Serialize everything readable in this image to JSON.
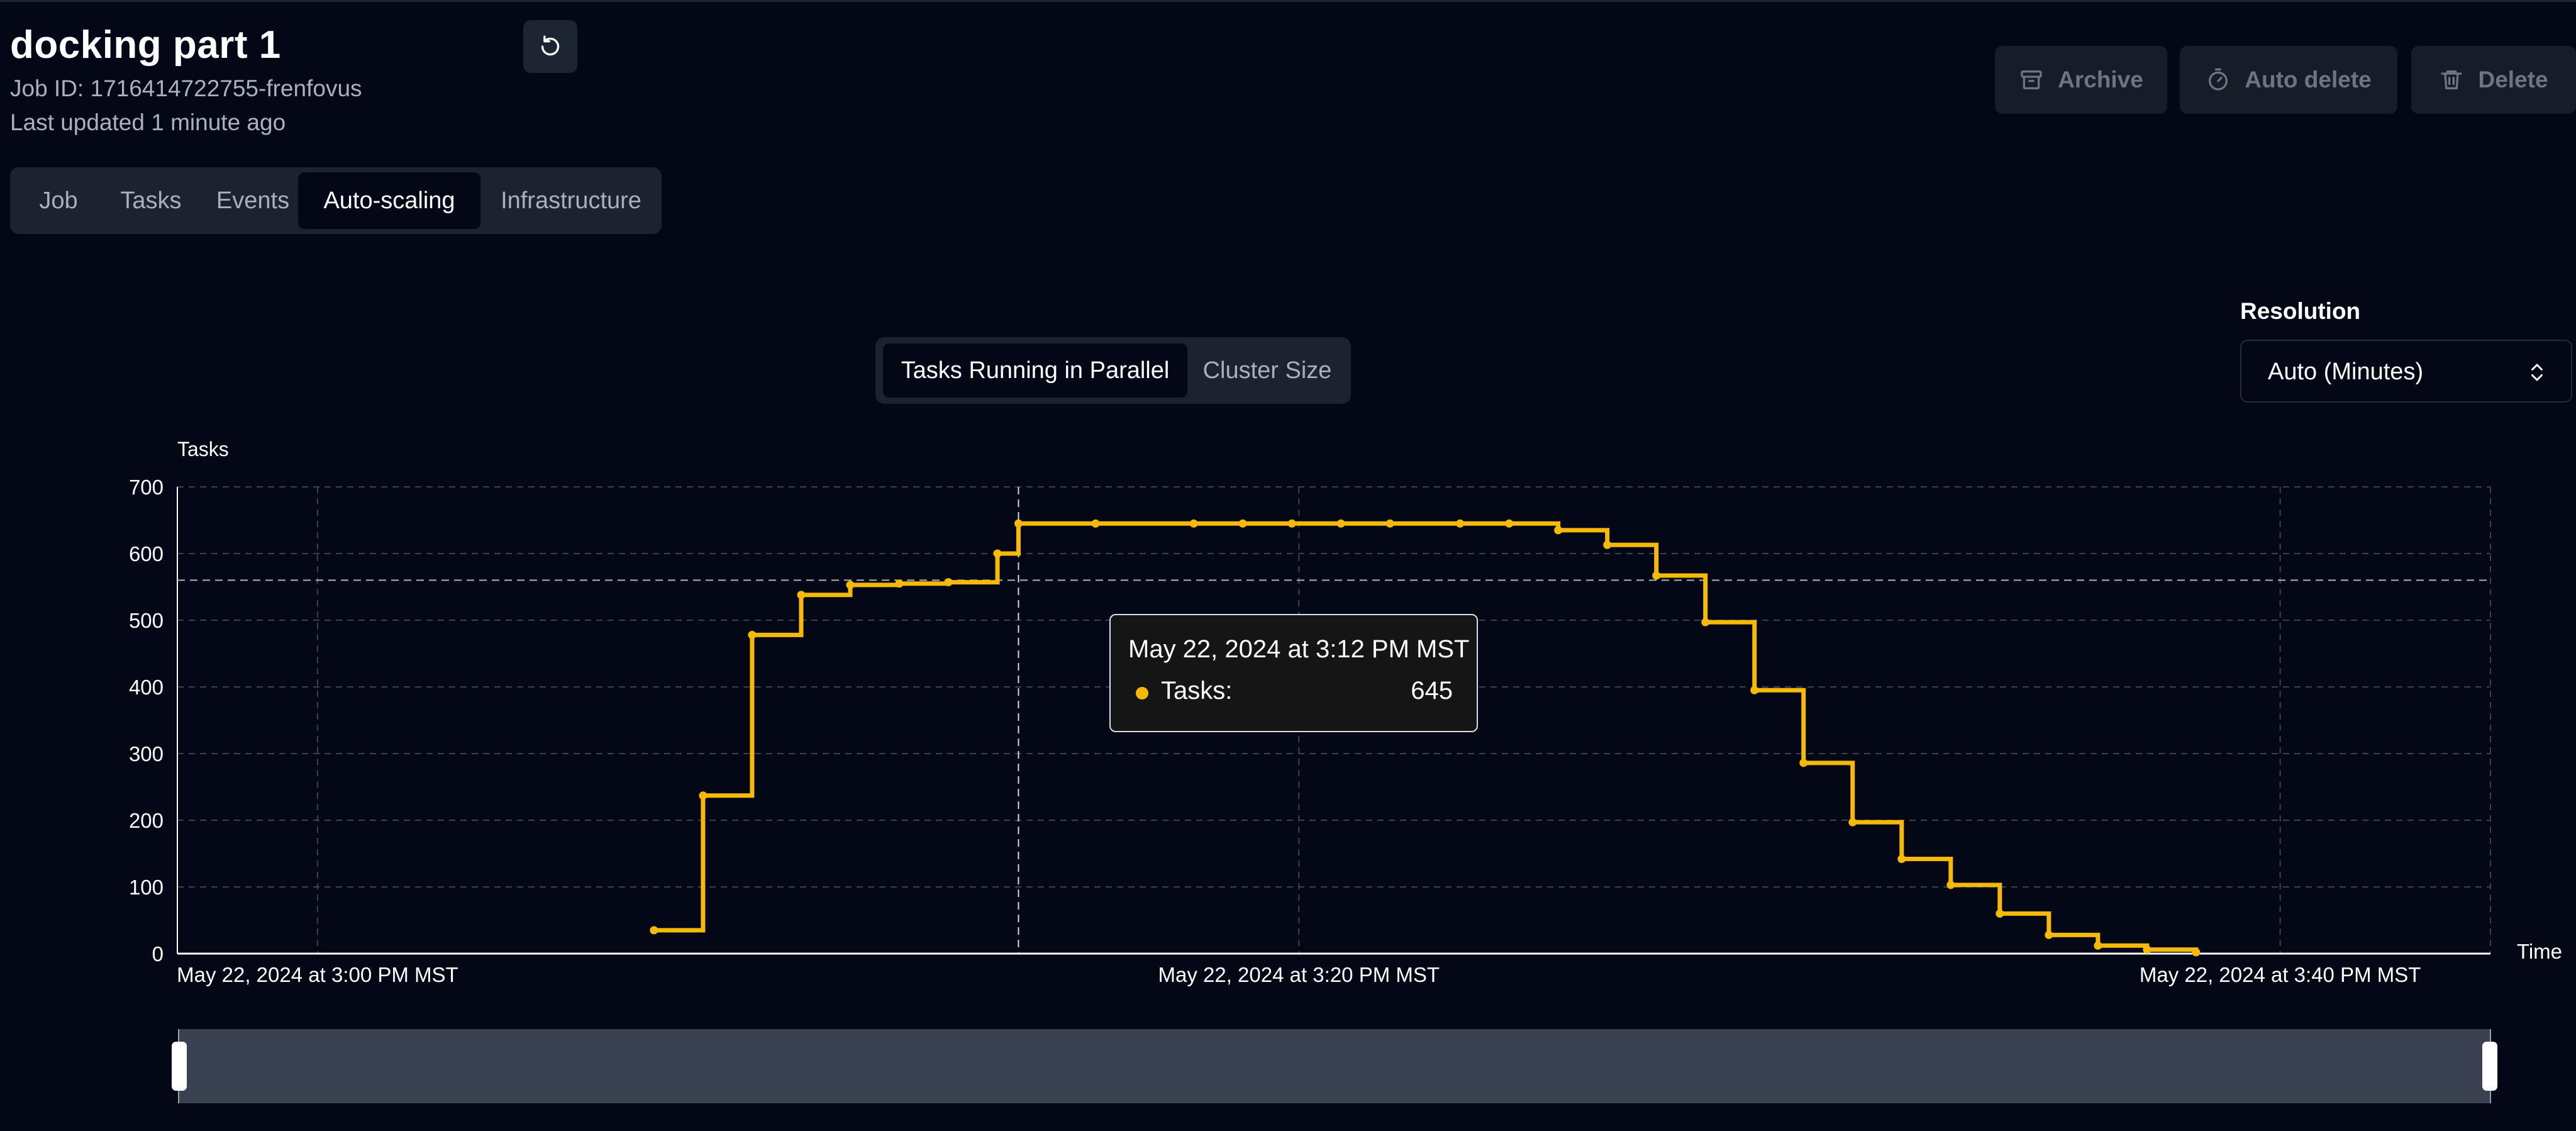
{
  "job": {
    "title": "docking part 1",
    "job_id_text": "Job ID: 1716414722755-frenfovus",
    "last_updated": "Last updated 1 minute ago"
  },
  "actions": {
    "archive": "Archive",
    "auto_delete": "Auto delete",
    "delete": "Delete"
  },
  "tabs": [
    {
      "label": "Job",
      "active": false
    },
    {
      "label": "Tasks",
      "active": false
    },
    {
      "label": "Events",
      "active": false
    },
    {
      "label": "Auto-scaling",
      "active": true
    },
    {
      "label": "Infrastructure",
      "active": false
    }
  ],
  "metric_toggle": [
    {
      "label": "Tasks Running in Parallel",
      "active": true
    },
    {
      "label": "Cluster Size",
      "active": false
    }
  ],
  "resolution": {
    "label": "Resolution",
    "value": "Auto (Minutes)"
  },
  "tooltip": {
    "title": "May 22, 2024 at 3:12 PM MST",
    "series_label": "Tasks:",
    "value": "645"
  },
  "colors": {
    "series": "#f5b90a",
    "background": "#040816",
    "grid": "#3b4252"
  },
  "icons": {
    "refresh": "refresh-icon",
    "archive": "archive-icon",
    "auto_delete": "timer-icon",
    "delete": "trash-icon",
    "select": "chevron-up-down-icon"
  },
  "range_slider": {
    "start": 0,
    "end": 1
  },
  "chart_data": {
    "type": "line",
    "step": "after",
    "ylabel": "Tasks",
    "xlabel": "Time",
    "ylim": [
      0,
      700
    ],
    "yticks": [
      0,
      100,
      200,
      300,
      400,
      500,
      600,
      700
    ],
    "xlim": [
      2.5,
      43.75
    ],
    "xticks": [
      {
        "value": 5,
        "label": "May 22, 2024 at 3:00 PM MST"
      },
      {
        "value": 22.5,
        "label": "May 22, 2024 at 3:20 PM MST"
      },
      {
        "value": 40,
        "label": "May 22, 2024 at 3:40 PM MST"
      }
    ],
    "x_unit": "minutes after 2:55 PM MST",
    "hover": {
      "x": 17.5,
      "y": 645
    },
    "reference_line": {
      "y": 560
    },
    "series": [
      {
        "x": [
          11,
          11.875,
          12.75,
          13.625,
          14.5,
          15.375,
          16.25,
          17.125,
          17.5,
          18.875,
          20.625,
          21.5,
          22.375,
          23.25,
          24.125,
          25.375,
          26.25,
          27.125,
          28,
          28.875,
          29.75,
          30.625,
          31.5,
          32.375,
          33.25,
          34.125,
          35,
          35.875,
          36.75,
          37.625,
          38.5
        ],
        "y": [
          35,
          237,
          478,
          538,
          553,
          555,
          557,
          600,
          645,
          645,
          645,
          645,
          645,
          645,
          645,
          645,
          645,
          635,
          613,
          567,
          497,
          395,
          286,
          197,
          142,
          103,
          60,
          28,
          12,
          6,
          2
        ]
      }
    ]
  }
}
